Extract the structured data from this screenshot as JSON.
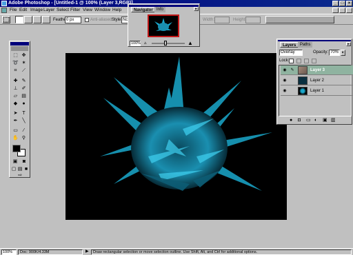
{
  "window": {
    "title": "Adobe Photoshop - [Untitled-1 @ 100% (Layer 3,RGB)]",
    "controls": [
      "_",
      "□",
      "×"
    ]
  },
  "menu": [
    "File",
    "Edit",
    "Image",
    "Layer",
    "Select",
    "Filter",
    "View",
    "Window",
    "Help"
  ],
  "options": {
    "feather_label": "Feather:",
    "feather_value": "0 px",
    "antialiased_label": "Anti-aliased",
    "style_label": "Style:",
    "style_value": "No",
    "width_label": "Width:",
    "height_label": "Height:"
  },
  "navigator": {
    "tabs": [
      "Navigator",
      "Info"
    ],
    "zoom": "100%"
  },
  "layers": {
    "tabs": [
      "Layers",
      "Paths"
    ],
    "blend_mode": "Overlay",
    "opacity_label": "Opacity:",
    "opacity_value": "70%",
    "lock_label": "Lock:",
    "items": [
      {
        "name": "Layer 3",
        "selected": true
      },
      {
        "name": "Layer 2",
        "selected": false
      },
      {
        "name": "Layer 1",
        "selected": false
      }
    ]
  },
  "status": {
    "zoom": "100%",
    "doc": "Doc: 900K/4.33M",
    "hint": "Draw rectangular selection or move selection outline. Use Shift, Alt, and Ctrl for additional options."
  },
  "colors": {
    "titlebar": "#00007b",
    "selected_layer": "#8fb3a0",
    "artwork": "#1a9ec0"
  }
}
